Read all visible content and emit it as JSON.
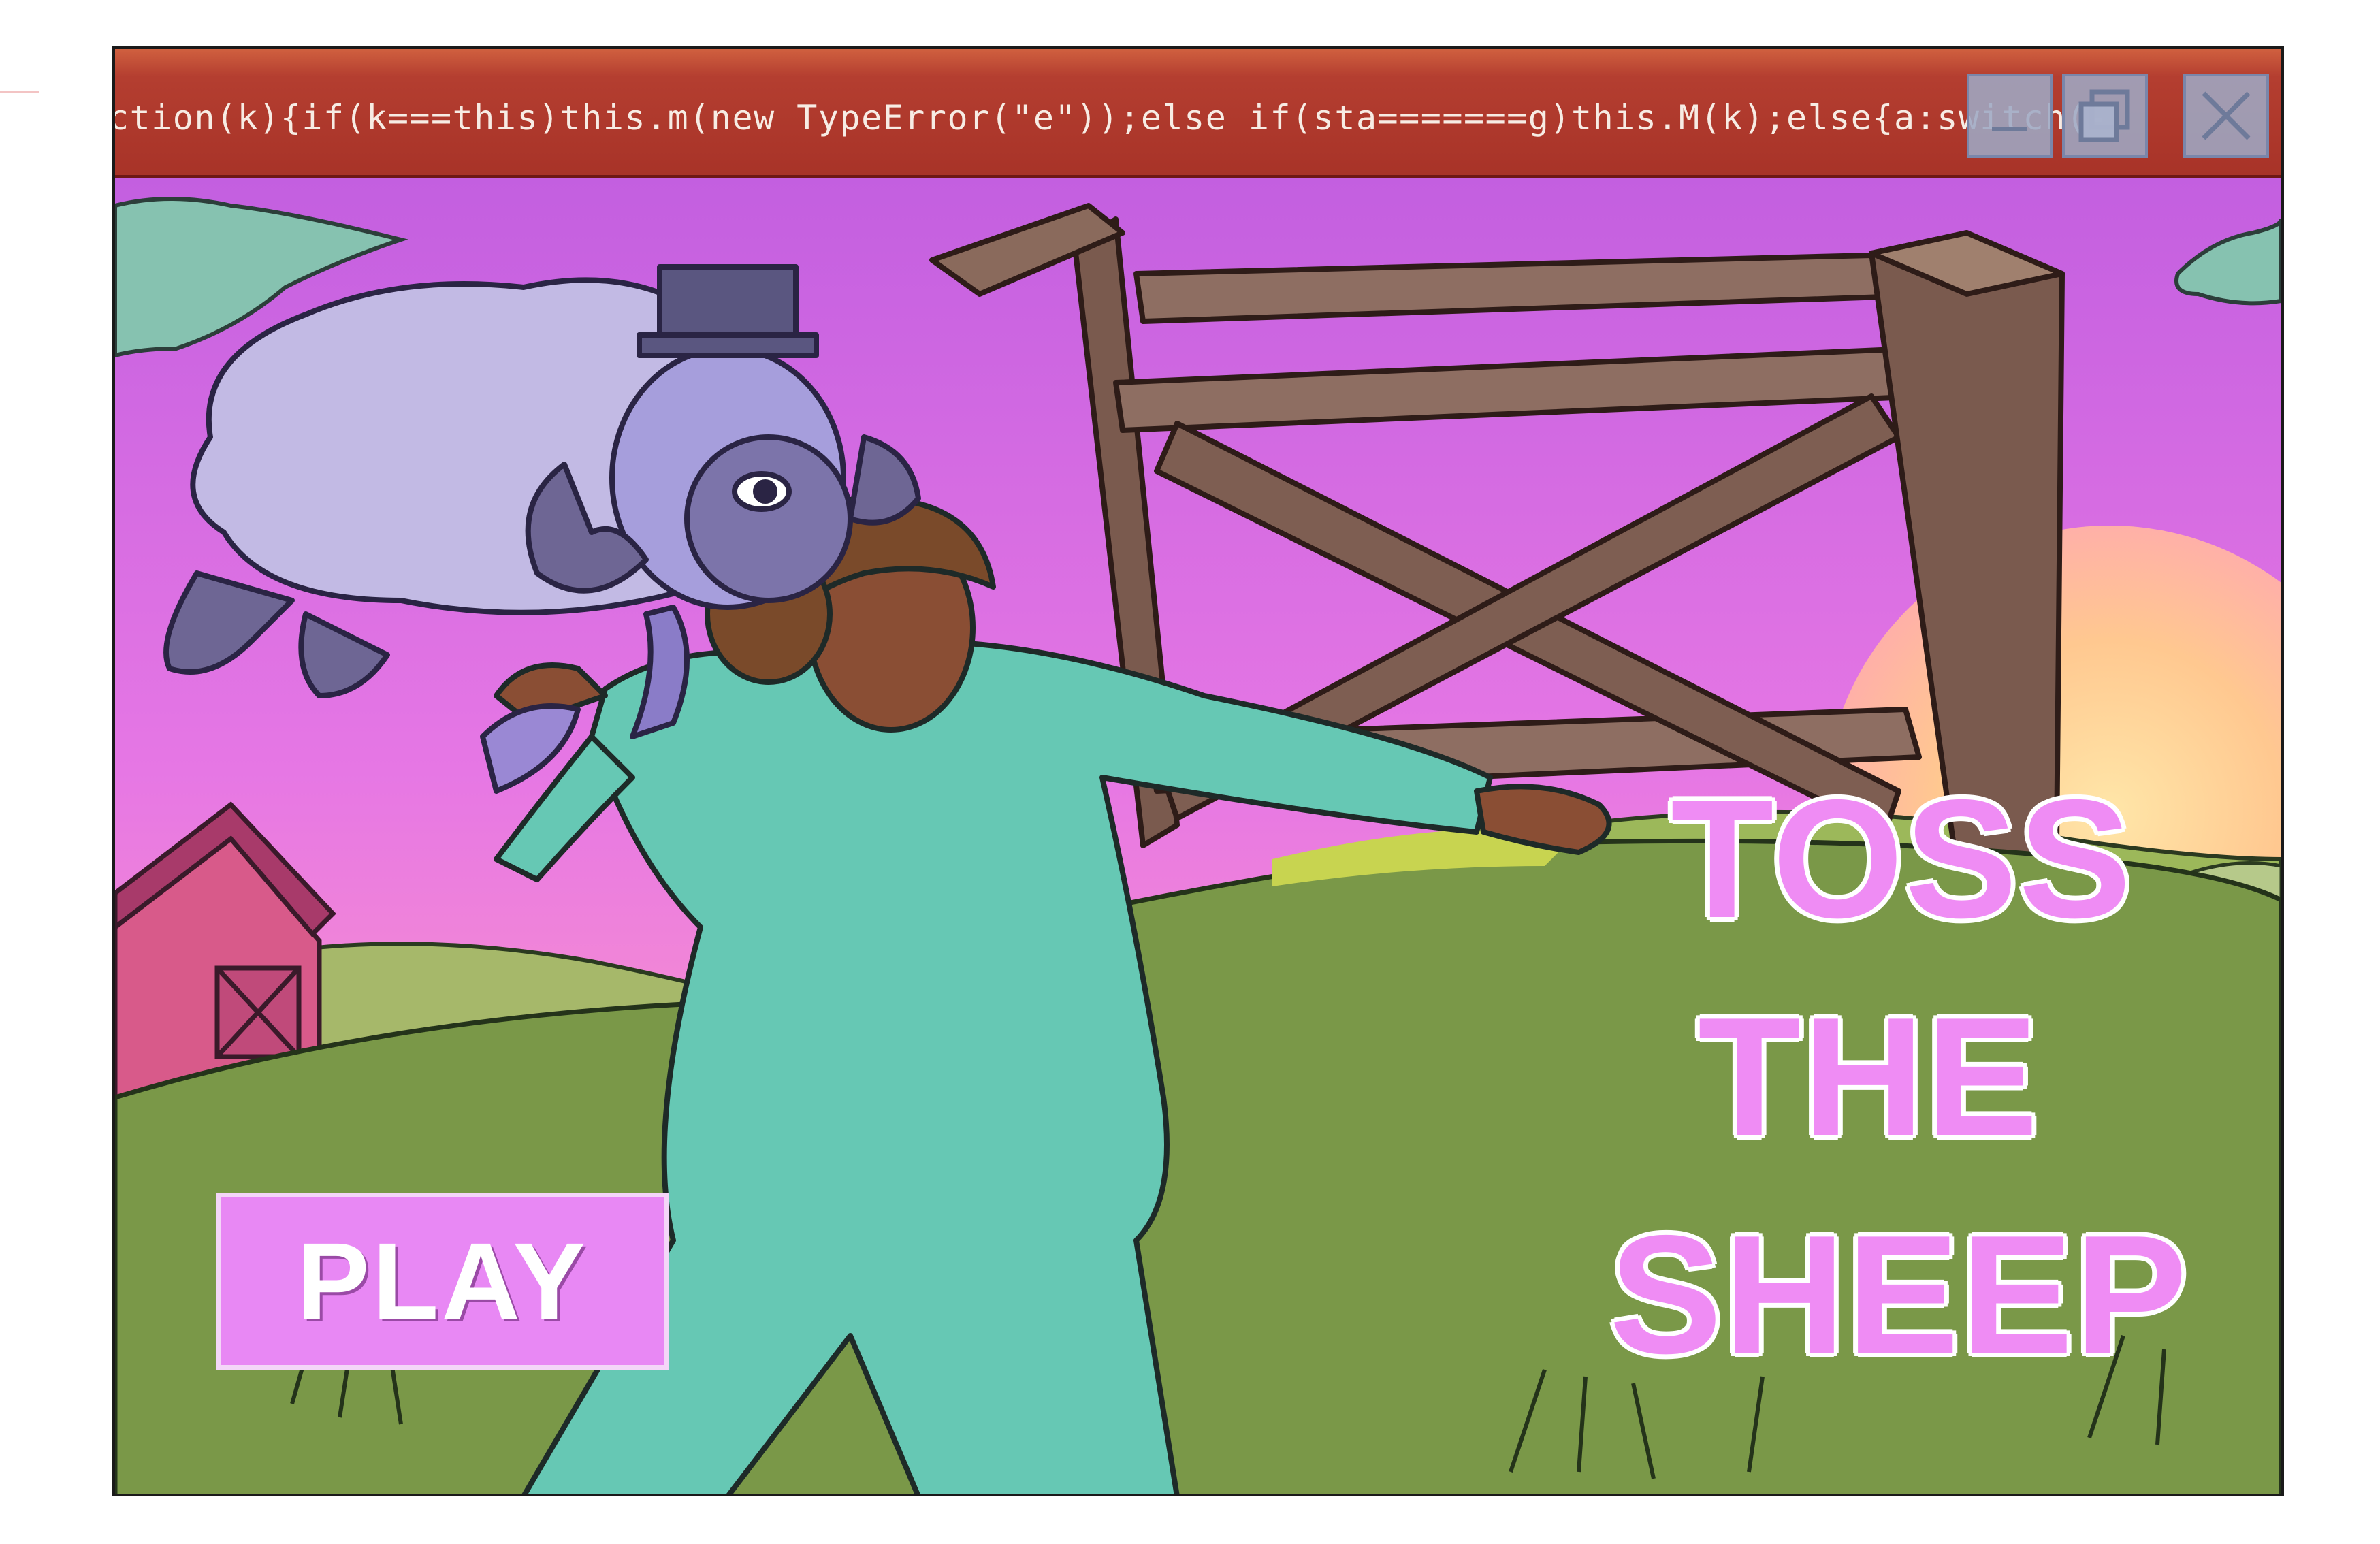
{
  "window": {
    "title_text": "ction(k){if(k===this)this.m(new TypeError(\"e\"));else if(sta=======g)this.M(k);else{a:switch(-",
    "buttons": [
      {
        "icon": "minimize-icon"
      },
      {
        "icon": "restore-icon"
      },
      {
        "icon": "close-icon"
      }
    ]
  },
  "game": {
    "title_lines": [
      "TOSS",
      "THE",
      "SHEEP"
    ],
    "play_label": "PLAY"
  },
  "colors": {
    "titlebar": "#b43e30",
    "sky_top": "#c660e0",
    "sky_bottom": "#ff9ec0",
    "grass": "#7a9848",
    "title_text": "#ef8cf4",
    "play_button": "#e888f4"
  }
}
